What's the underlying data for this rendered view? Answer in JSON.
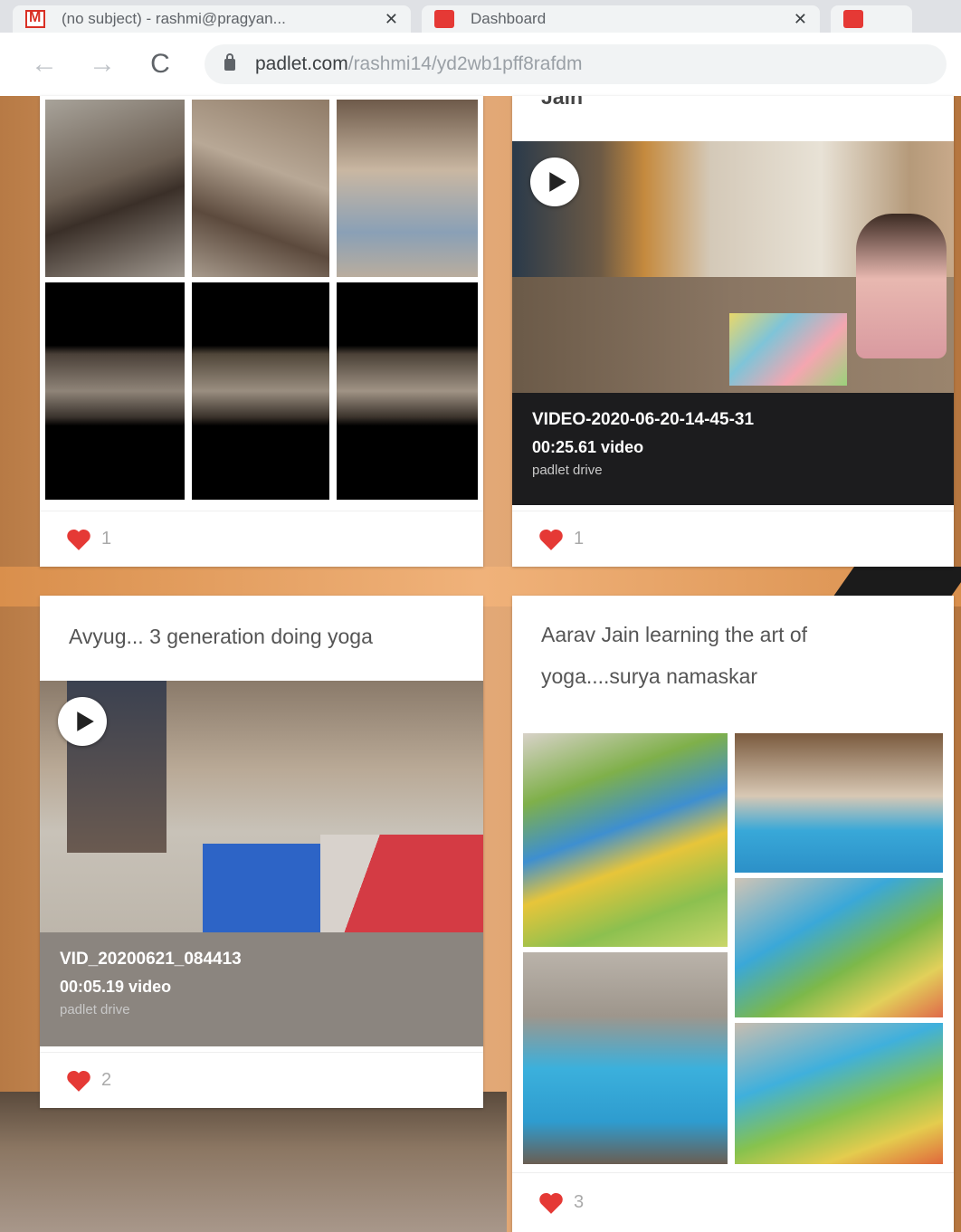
{
  "browser": {
    "tabs": [
      {
        "title": "(no subject) - rashmi@pragyan...",
        "close": "✕"
      },
      {
        "title": "Dashboard",
        "close": "✕"
      },
      {
        "title": "",
        "close": ""
      }
    ],
    "nav": {
      "back": "←",
      "forward": "→",
      "reload": "C"
    },
    "url": {
      "host": "padlet.com",
      "path": "/rashmi14/yd2wb1pff8rafdm"
    }
  },
  "cards": {
    "c1": {
      "likes": "1"
    },
    "c2": {
      "title_tail": "Jain",
      "video_name": "VIDEO-2020-06-20-14-45-31",
      "video_meta": "00:25.61 video",
      "video_source": "padlet drive",
      "likes": "1"
    },
    "c3": {
      "title": "Avyug... 3 generation doing yoga",
      "video_name": "VID_20200621_084413",
      "video_meta": "00:05.19 video",
      "video_source": "padlet drive",
      "likes": "2"
    },
    "c4": {
      "title": "Aarav Jain learning the art of yoga....surya namaskar",
      "likes": "3"
    }
  },
  "icons": {
    "heart": "heart-icon",
    "play": "play-icon",
    "lock": "lock-icon"
  },
  "colors": {
    "heart": "#e53935",
    "video_bar_dark": "#1c1c1e",
    "video_bar_grey": "#8b857f"
  }
}
